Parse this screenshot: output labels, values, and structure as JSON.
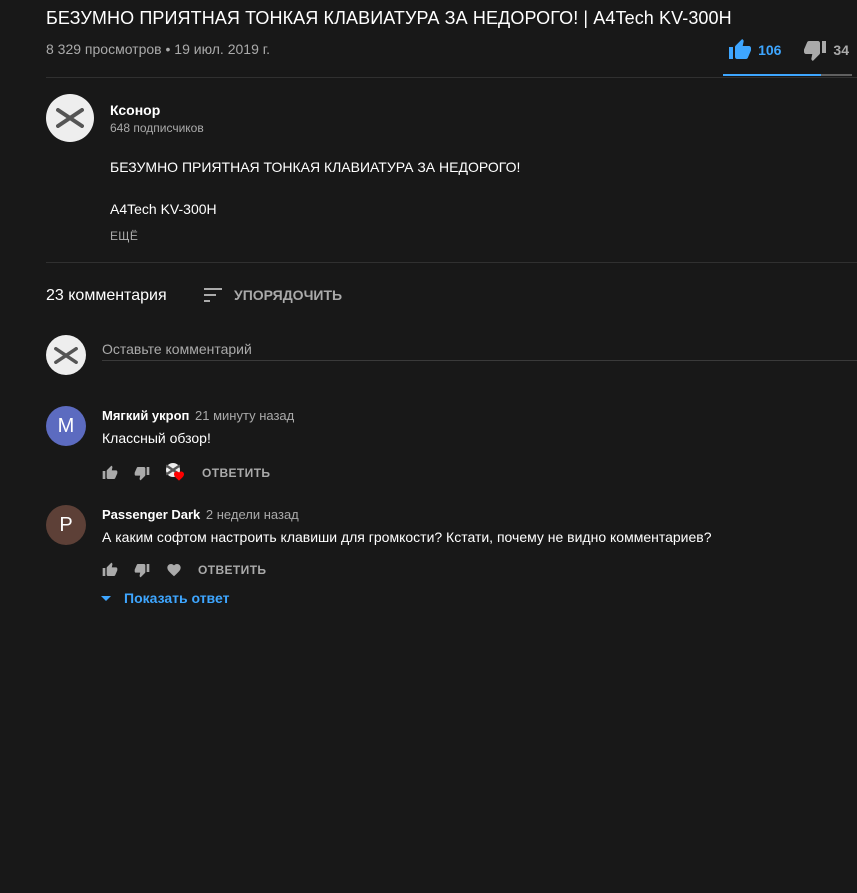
{
  "video": {
    "title": "БЕЗУМНО ПРИЯТНАЯ ТОНКАЯ КЛАВИАТУРА ЗА НЕДОРОГО! | A4Tech KV-300H",
    "meta": "8 329 просмотров • 19 июл. 2019 г.",
    "likes": "106",
    "dislikes": "34",
    "like_ratio": 0.76
  },
  "channel": {
    "name": "Ксонор",
    "subscribers": "648 подписчиков",
    "avatar_icon": "x-logo-icon"
  },
  "description": {
    "line1": "БЕЗУМНО ПРИЯТНАЯ ТОНКАЯ КЛАВИАТУРА ЗА НЕДОРОГО!",
    "line2": "A4Tech KV-300H",
    "more_label": "ЕЩЁ"
  },
  "comments_section": {
    "count_label": "23 комментария",
    "sort_label": "УПОРЯДОЧИТЬ",
    "input_placeholder": "Оставьте комментарий"
  },
  "comments": [
    {
      "avatar_letter": "M",
      "avatar_color": "#5c6bc0",
      "author": "Мягкий укроп",
      "time": "21 минуту назад",
      "text": "Классный обзор!",
      "reply_label": "ОТВЕТИТЬ",
      "creator_heart": true
    },
    {
      "avatar_letter": "P",
      "avatar_color": "#5d4037",
      "author": "Passenger Dark",
      "time": "2 недели назад",
      "text": "А каким софтом настроить клавиши для громкости? Кстати, почему не видно комментариев?",
      "reply_label": "ОТВЕТИТЬ",
      "creator_heart": false,
      "show_replies_label": "Показать ответ"
    }
  ],
  "colors": {
    "background": "#181818",
    "accent": "#3ea6ff",
    "secondary_text": "#aaaaaa",
    "heart": "#ff0000"
  }
}
